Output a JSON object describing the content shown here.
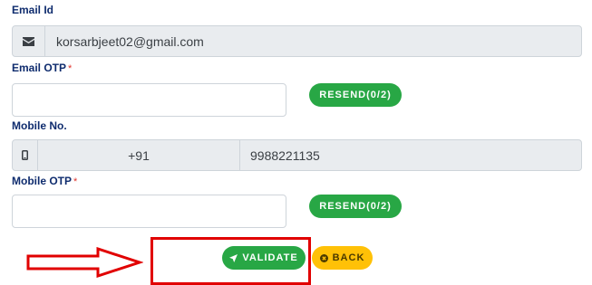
{
  "email": {
    "label": "Email Id",
    "value": "korsarbjeet02@gmail.com",
    "icon": "envelope-icon"
  },
  "email_otp": {
    "label": "Email OTP",
    "required_mark": "*",
    "value": "",
    "resend_label": "RESEND(0/2)"
  },
  "mobile": {
    "label": "Mobile No.",
    "country_code": "+91",
    "number": "9988221135",
    "icon": "mobile-phone-icon"
  },
  "mobile_otp": {
    "label": "Mobile OTP",
    "required_mark": "*",
    "value": "",
    "resend_label": "RESEND(0/2)"
  },
  "actions": {
    "validate_label": "VALIDATE",
    "back_label": "BACK"
  },
  "colors": {
    "label": "#0f2c6e",
    "success": "#28a745",
    "warning": "#ffc107",
    "annotation": "#e10000"
  }
}
